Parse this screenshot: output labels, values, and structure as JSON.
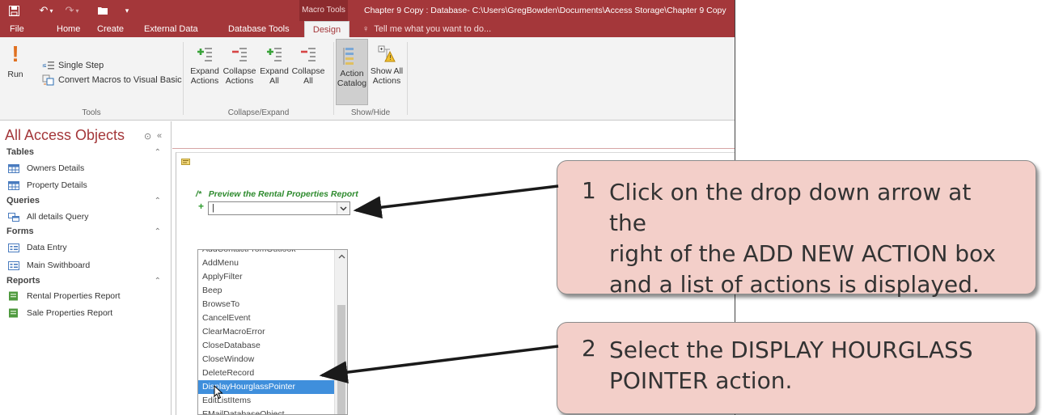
{
  "window": {
    "context_tab": "Macro Tools",
    "doc_title": "Chapter 9 Copy : Database- C:\\Users\\GregBowden\\Documents\\Access Storage\\Chapter 9 Copy"
  },
  "ribbon": {
    "tabs": [
      "File",
      "Home",
      "Create",
      "External Data",
      "Database Tools",
      "Design"
    ],
    "active_tab": "Design",
    "tell_me": "Tell me what you want to do...",
    "tools": {
      "run": "Run",
      "single_step": "Single Step",
      "convert": "Convert Macros to Visual Basic",
      "group": "Tools"
    },
    "collapse_expand": {
      "expand_actions": [
        "Expand",
        "Actions"
      ],
      "collapse_actions": [
        "Collapse",
        "Actions"
      ],
      "expand_all": [
        "Expand",
        "All"
      ],
      "collapse_all": [
        "Collapse",
        "All"
      ],
      "group": "Collapse/Expand"
    },
    "show_hide": {
      "action_catalog": [
        "Action",
        "Catalog"
      ],
      "show_all_actions": [
        "Show All",
        "Actions"
      ],
      "group": "Show/Hide"
    }
  },
  "nav": {
    "title": "All Access Objects",
    "sections": [
      {
        "header": "Tables",
        "items": [
          "Owners Details",
          "Property Details"
        ]
      },
      {
        "header": "Queries",
        "items": [
          "All details Query"
        ]
      },
      {
        "header": "Forms",
        "items": [
          "Data Entry",
          "Main Swithboard"
        ]
      },
      {
        "header": "Reports",
        "items": [
          "Rental Properties Report",
          "Sale Properties Report"
        ]
      }
    ]
  },
  "macro": {
    "comment_prefix": "/*",
    "comment": "Preview the Rental Properties Report",
    "new_action_value": "|"
  },
  "action_list": {
    "items": [
      "AddContactFromOutlook",
      "AddMenu",
      "ApplyFilter",
      "Beep",
      "BrowseTo",
      "CancelEvent",
      "ClearMacroError",
      "CloseDatabase",
      "CloseWindow",
      "DeleteRecord",
      "DisplayHourglassPointer",
      "EditListItems",
      "EMailDatabaseObject"
    ],
    "selected": "DisplayHourglassPointer"
  },
  "callouts": [
    {
      "number": "1",
      "lines": [
        "Click on the drop down arrow at the",
        "right of the ADD NEW ACTION box",
        "and a list of actions is displayed."
      ]
    },
    {
      "number": "2",
      "lines": [
        "Select the DISPLAY HOURGLASS",
        "POINTER action."
      ]
    }
  ],
  "colors": {
    "access_red": "#a4373a",
    "callout_fill": "#f3cfc9",
    "selection": "#3f8fdc",
    "comment_green": "#2e8b2e"
  }
}
